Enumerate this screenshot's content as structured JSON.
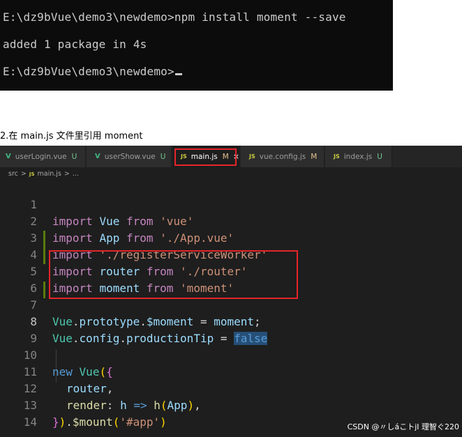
{
  "terminal": {
    "lines": [
      "E:\\dz9bVue\\demo3\\newdemo>npm install moment --save",
      "added 1 package in 4s",
      "E:\\dz9bVue\\demo3\\newdemo>"
    ]
  },
  "caption": "2.在 main.js 文件里引用 moment",
  "editor": {
    "tabs": [
      {
        "icon": "V",
        "label": "userLogin.vue",
        "status": "U"
      },
      {
        "icon": "V",
        "label": "userShow.vue",
        "status": "U"
      },
      {
        "icon": "JS",
        "label": "main.js",
        "status": "M",
        "close": "×"
      },
      {
        "icon": "JS",
        "label": "vue.config.js",
        "status": "M"
      },
      {
        "icon": "JS",
        "label": "index.js",
        "status": "U"
      }
    ],
    "breadcrumb": {
      "folder": "src",
      "sep": ">",
      "js_icon": "JS",
      "file": "main.js",
      "sep2": ">",
      "more": "..."
    },
    "line_numbers": [
      "1",
      "2",
      "3",
      "4",
      "5",
      "6",
      "7",
      "8",
      "9",
      "10",
      "11",
      "12",
      "13",
      "14"
    ],
    "code": {
      "l1": [
        "import",
        " ",
        "Vue",
        " ",
        "from",
        " ",
        "'vue'"
      ],
      "l2": [
        "import",
        " ",
        "App",
        " ",
        "from",
        " ",
        "'./App.vue'"
      ],
      "l3": [
        "import",
        " ",
        "'./registerServiceWorker'"
      ],
      "l4": [
        "import",
        " ",
        "router",
        " ",
        "from",
        " ",
        "'./router'"
      ],
      "l5": [
        "import",
        " ",
        "moment",
        " ",
        "from",
        " ",
        "'moment'"
      ],
      "l7": [
        "Vue",
        ".",
        "prototype",
        ".",
        "$moment",
        " = ",
        "moment",
        ";"
      ],
      "l8": [
        "Vue",
        ".",
        "config",
        ".",
        "productionTip",
        " = ",
        "false"
      ],
      "l10": [
        "new",
        " ",
        "Vue",
        "(",
        "{"
      ],
      "l11": [
        "router",
        ","
      ],
      "l12": [
        "render",
        ": ",
        "h",
        " ",
        "=>",
        " ",
        "h",
        "(",
        "App",
        ")",
        ","
      ],
      "l13": [
        "}",
        ")",
        ".",
        "$mount",
        "(",
        "'#app'",
        ")"
      ]
    }
  },
  "watermark": "CSDN @〃しáこトjI 理智ぐ220",
  "colors": {
    "highlight_box": "#e5252a",
    "terminal_bg": "#0c0c0c",
    "editor_bg": "#1e1e1e"
  }
}
